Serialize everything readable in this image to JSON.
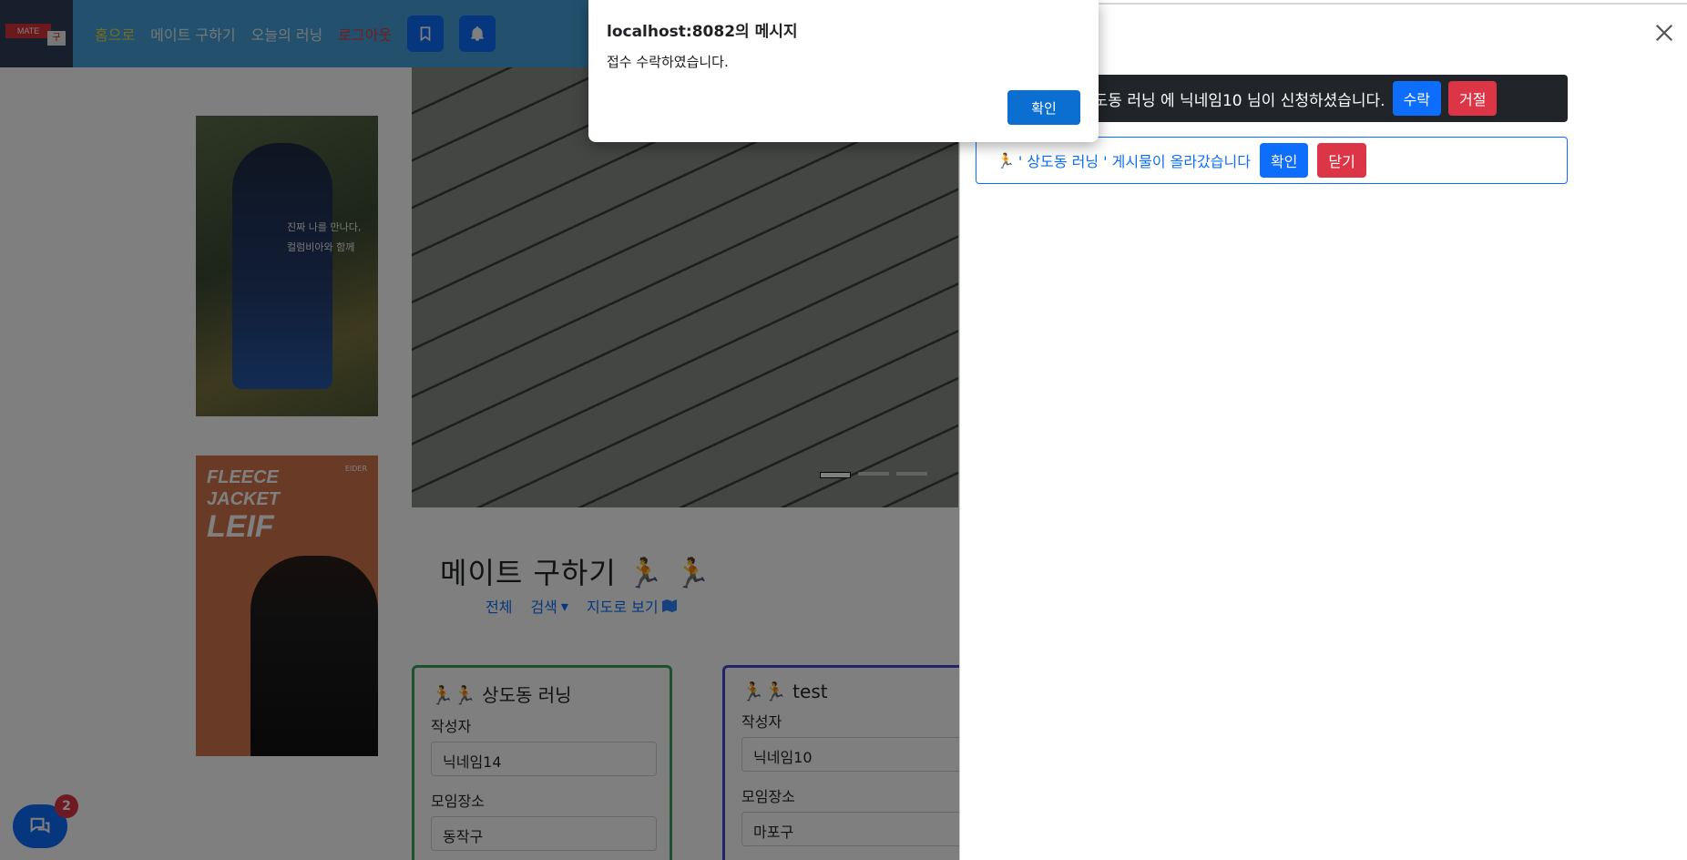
{
  "navbar": {
    "logo_text": "MATE",
    "logo_mark": "구",
    "links": {
      "home": "홈으로",
      "find_mate": "메이트 구하기",
      "today_run": "오늘의 러닝",
      "logout": "로그아웃"
    },
    "bookmark_icon": "bookmark-icon",
    "bell_icon": "bell-icon"
  },
  "ads": {
    "ad1_line1": "진짜 나를 만나다,",
    "ad1_line2": "컬럼비아와 함께",
    "ad2_line1": "FLEECE",
    "ad2_line2": "JACKET",
    "ad2_line3": "LEIF",
    "ad2_brand": "EIDER"
  },
  "main": {
    "title": "메이트 구하기",
    "tabs": {
      "all": "전체",
      "search": "검색",
      "map": "지도로 보기"
    },
    "cards": [
      {
        "title": "상도동 러닝",
        "author_label": "작성자",
        "author": "닉네임14",
        "place_label": "모임장소",
        "place": "동작구",
        "border_color": "#3aa35a"
      },
      {
        "title": "test",
        "author_label": "작성자",
        "author": "닉네임10",
        "place_label": "모임장소",
        "place": "마포구",
        "border_color": "#4b48d6"
      }
    ]
  },
  "chat": {
    "badge_count": "2"
  },
  "offcanvas": {
    "notifications": [
      {
        "text": "상도동 러닝 에 닉네임10 님이 신청하셨습니다.",
        "accept_label": "수락",
        "reject_label": "거절"
      },
      {
        "text": "' 상도동 러닝 ' 게시물이 올라갔습니다",
        "confirm_label": "확인",
        "close_label": "닫기"
      }
    ]
  },
  "dialog": {
    "title": "localhost:8082의 메시지",
    "message": "접수 수락하였습니다.",
    "ok_label": "확인"
  },
  "colors": {
    "primary": "#0d6efd",
    "danger": "#dc3545",
    "navbar": "#46a2da",
    "dark": "#212529"
  }
}
